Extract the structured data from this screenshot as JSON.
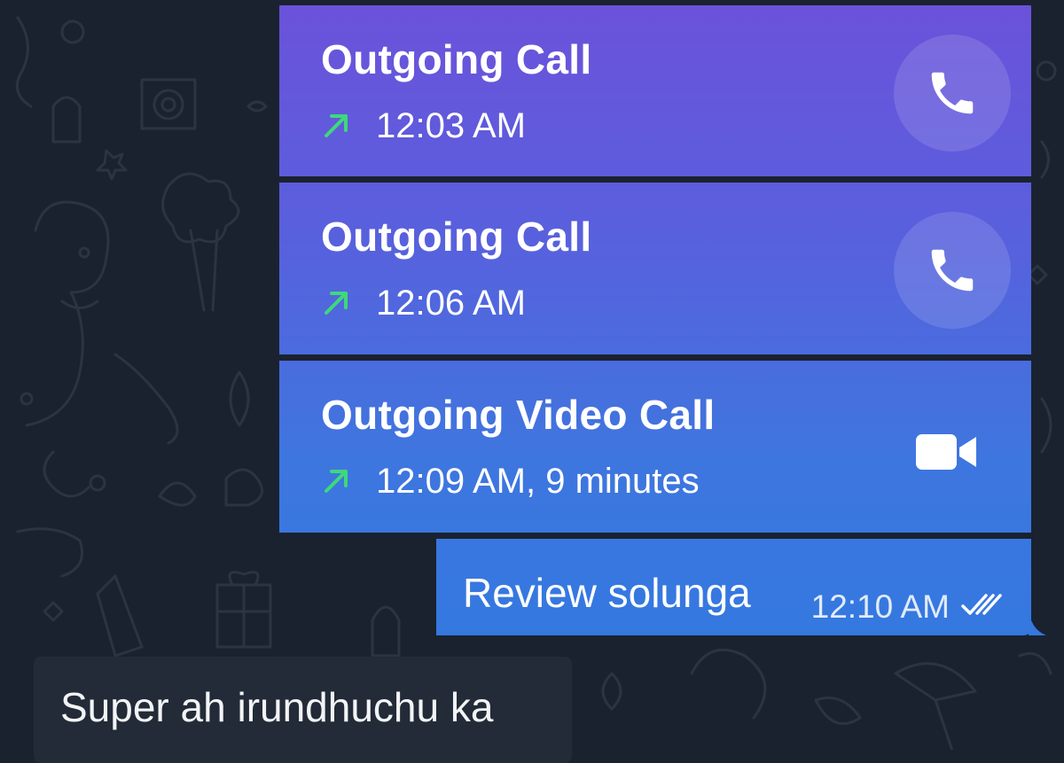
{
  "colors": {
    "background": "#1a2230",
    "bubble_gradient_top": "#6b52da",
    "bubble_gradient_bottom": "#3478e0",
    "incoming_bubble": "#222b37",
    "outgoing_arrow": "#3fd87a"
  },
  "messages": {
    "calls": [
      {
        "title": "Outgoing Call",
        "meta": "12:03 AM",
        "icon": "phone-icon",
        "direction": "outgoing"
      },
      {
        "title": "Outgoing Call",
        "meta": "12:06 AM",
        "icon": "phone-icon",
        "direction": "outgoing"
      },
      {
        "title": "Outgoing Video Call",
        "meta": "12:09 AM, 9 minutes",
        "icon": "video-camera-icon",
        "direction": "outgoing"
      }
    ],
    "outgoing_text": {
      "text": "Review solunga",
      "time": "12:10 AM",
      "status_icon": "double-check-icon"
    },
    "incoming_text": {
      "text": "Super ah irundhuchu ka"
    }
  }
}
